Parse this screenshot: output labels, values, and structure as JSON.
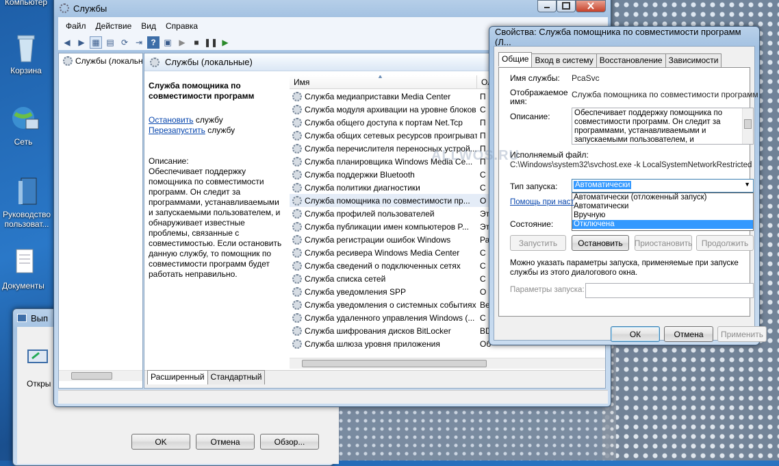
{
  "desktop": {
    "icons": [
      {
        "label": "Компьютер"
      },
      {
        "label": "Корзина"
      },
      {
        "label": "Сеть"
      },
      {
        "label": "Руководство пользоват..."
      },
      {
        "label": "Документы"
      }
    ]
  },
  "run_dialog": {
    "title": "Вып",
    "open_label": "Откры",
    "ok": "OK",
    "cancel": "Отмена",
    "browse": "Обзор..."
  },
  "services_window": {
    "title": "Службы",
    "menu": [
      "Файл",
      "Действие",
      "Вид",
      "Справка"
    ],
    "tree_item": "Службы (локальн",
    "header_title": "Службы (локальные)",
    "selected_service": "Служба помощника по совместимости программ",
    "action_stop_link": "Остановить",
    "action_stop_tail": " службу",
    "action_restart_link": "Перезапустить",
    "action_restart_tail": " службу",
    "description_label": "Описание:",
    "description_text": "Обеспечивает поддержку помощника по совместимости программ. Он следит за программами, устанавливаемыми и запускаемыми пользователем, и обнаруживает известные проблемы, связанные с совместимостью. Если остановить данную службу, то помощник по совместимости программ будет работать неправильно.",
    "col_name": "Имя",
    "col_desc": "Ол",
    "rows": [
      {
        "name": "Служба медиаприставки Media Center",
        "d": "П"
      },
      {
        "name": "Служба модуля архивации на уровне блоков",
        "d": "С"
      },
      {
        "name": "Служба общего доступа к портам Net.Tcp",
        "d": "П"
      },
      {
        "name": "Служба общих сетевых ресурсов проигрыват...",
        "d": "П"
      },
      {
        "name": "Служба перечислителя переносных устрой...",
        "d": "П"
      },
      {
        "name": "Служба планировщика Windows Media Ce...",
        "d": "П"
      },
      {
        "name": "Служба поддержки Bluetooth",
        "d": "С"
      },
      {
        "name": "Служба политики диагностики",
        "d": "С"
      },
      {
        "name": "Служба помощника по совместимости пр...",
        "d": "О"
      },
      {
        "name": "Служба профилей пользователей",
        "d": "Эт"
      },
      {
        "name": "Служба публикации имен компьютеров P...",
        "d": "Эт"
      },
      {
        "name": "Служба регистрации ошибок Windows",
        "d": "Ра"
      },
      {
        "name": "Служба ресивера Windows Media Center",
        "d": "С"
      },
      {
        "name": "Служба сведений о подключенных сетях",
        "d": "С"
      },
      {
        "name": "Служба списка сетей",
        "d": "С"
      },
      {
        "name": "Служба уведомления SPP",
        "d": "О"
      },
      {
        "name": "Служба уведомления о системных событиях",
        "d": "Ве"
      },
      {
        "name": "Служба удаленного управления Windows (...",
        "d": "С"
      },
      {
        "name": "Служба шифрования дисков BitLocker",
        "d": "BD"
      },
      {
        "name": "Служба шлюза уровня приложения",
        "d": "Об"
      }
    ],
    "tab_extended": "Расширенный",
    "tab_standard": "Стандартный"
  },
  "properties_dialog": {
    "title": "Свойства: Служба помощника по совместимости программ (Л...",
    "tabs": [
      "Общие",
      "Вход в систему",
      "Восстановление",
      "Зависимости"
    ],
    "service_name_label": "Имя службы:",
    "service_name_value": "PcaSvc",
    "display_name_label": "Отображаемое имя:",
    "display_name_value": "Служба помощника по совместимости программ",
    "description_label": "Описание:",
    "description_value": "Обеспечивает поддержку помощника по совместимости программ. Он следит за программами, устанавливаемыми и запускаемыми пользователем, и обнаруживает",
    "exe_label": "Исполняемый файл:",
    "exe_value": "C:\\Windows\\system32\\svchost.exe -k LocalSystemNetworkRestricted",
    "startup_label": "Тип запуска:",
    "startup_value": "Автоматически",
    "startup_options": [
      "Автоматически (отложенный запуск)",
      "Автоматически",
      "Вручную",
      "Отключена"
    ],
    "help_link": "Помощь при наст",
    "status_label": "Состояние:",
    "btn_start": "Запустить",
    "btn_stop": "Остановить",
    "btn_pause": "Приостановить",
    "btn_resume": "Продолжить",
    "params_note": "Можно указать параметры запуска, применяемые при запуске службы из этого диалогового окна.",
    "params_label": "Параметры запуска:",
    "ok": "ОК",
    "cancel": "Отмена",
    "apply": "Применить"
  },
  "watermark": "ALLWOS.RU",
  "colors": {
    "selection": "#3399ff",
    "link": "#0645ad"
  }
}
